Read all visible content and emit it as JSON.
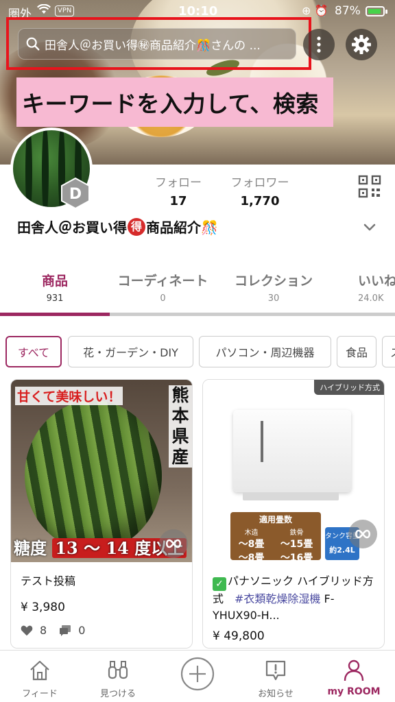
{
  "status_bar": {
    "carrier": "圏外",
    "vpn": "VPN",
    "time": "10:10",
    "battery": "87%"
  },
  "search": {
    "placeholder": "田舎人＠お買い得㊙商品紹介🎊さんの ..."
  },
  "annotation": {
    "label": "キーワードを入力して、検索"
  },
  "profile": {
    "badge_letter": "D",
    "follow_label": "フォロー",
    "follow_count": "17",
    "follower_label": "フォロワー",
    "follower_count": "1,770",
    "name_prefix": "田舎人＠お買い得",
    "name_badge": "得",
    "name_suffix": "商品紹介🎊"
  },
  "tabs": [
    {
      "label": "商品",
      "count": "931"
    },
    {
      "label": "コーディネート",
      "count": "0"
    },
    {
      "label": "コレクション",
      "count": "30"
    },
    {
      "label": "いいね",
      "count": "24.0K"
    }
  ],
  "chips": [
    "すべて",
    "花・ガーデン・DIY",
    "パソコン・周辺機器",
    "食品",
    "ス"
  ],
  "cards": [
    {
      "img_top_text": "甘くて美味しい！",
      "img_vertical_text": "熊本県産",
      "img_bottom_prefix": "糖度",
      "img_bottom_highlight": "13 〜 14 度以上",
      "title": "テスト投稿",
      "price": "¥ 3,980",
      "likes": "8",
      "comments": "0"
    },
    {
      "tag": "ハイブリッド方式",
      "panel_head": "適用畳数",
      "panel_wood": "木造",
      "panel_wood_50": "(50Hz)",
      "panel_wood_val": "〜8畳",
      "panel_wood_60": "(60Hz)",
      "panel_wood_val2": "〜8畳",
      "panel_steel": "鉄骨",
      "panel_steel_val": "〜15畳",
      "panel_steel_val2": "〜16畳",
      "tank_label": "タンク容量",
      "tank_val": "約2.4L",
      "title_main": "パナソニック ハイブリッド方式　",
      "title_tag": "#衣類乾燥除湿機",
      "title_rest": " F-YHUX90-H...",
      "price": "¥ 49,800"
    }
  ],
  "bottom_nav": {
    "feed": "フィード",
    "find": "見つける",
    "notice": "お知らせ",
    "room": "my ROOM"
  }
}
